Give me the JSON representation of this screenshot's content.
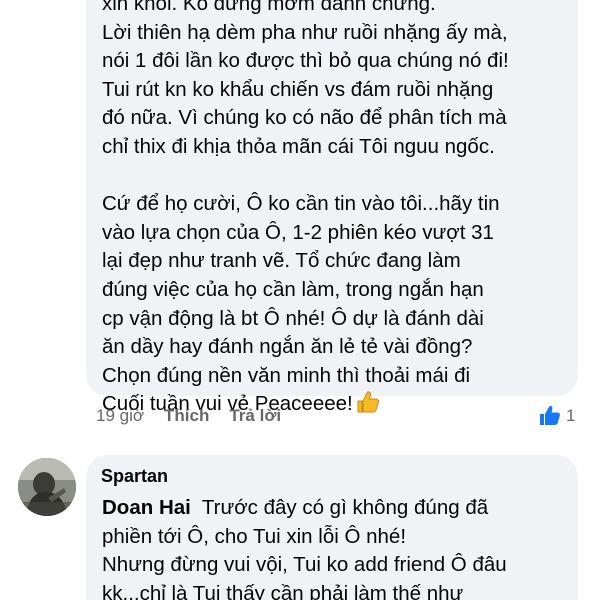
{
  "comment1": {
    "text": "xin khỏi. Ko đừng mớm đánh chứng.\nLời thiên hạ dèm pha như ruồi nhặng ấy mà,\nnói 1 đôi lần ko được thì bỏ qua chúng nó đi!\nTui rút kn ko khẩu chiến vs đám ruồi nhặng\nđó nữa. Vì chúng ko có não để phân tích mà\nchỉ thix đi khịa thỏa mãn cái Tôi nguu ngốc.\n\nCứ để họ cười, Ô ko cần tin vào tôi...hãy tin\nvào lựa chọn của Ô, 1-2 phiên kéo vượt 31\nlại đẹp như tranh vẽ. Tổ chức đang làm\nđúng việc của họ cần làm, trong ngắn hạn\ncp vận động là bt Ô nhé! Ô dự là đánh dài\năn dầy hay đánh ngắn ăn lẻ tẻ vài đồng?\nChọn đúng nền văn minh thì thoải mái đi\nCuối tuần vui vẻ Peaceeee!",
    "emoji": "thumbs-up",
    "time": "19 giờ",
    "like_label": "Thích",
    "reply_label": "Trả lời",
    "reaction_count": "1",
    "reaction_color": "#1877f2"
  },
  "comment2": {
    "author": "Spartan",
    "mention": "Doan Hai",
    "text_after_mention": "  Trước đây có gì không đúng đã\nphiền tới Ô, cho Tui xin lỗi Ô nhé!\nNhưng đừng vui vội, Tui ko add friend Ô đâu\nkk...chỉ là Tui thấy cần phải làm thế như"
  },
  "colors": {
    "bubble": "#f0f2f5",
    "meta_text": "#65676b",
    "thumb_emoji": "#f7b928"
  }
}
